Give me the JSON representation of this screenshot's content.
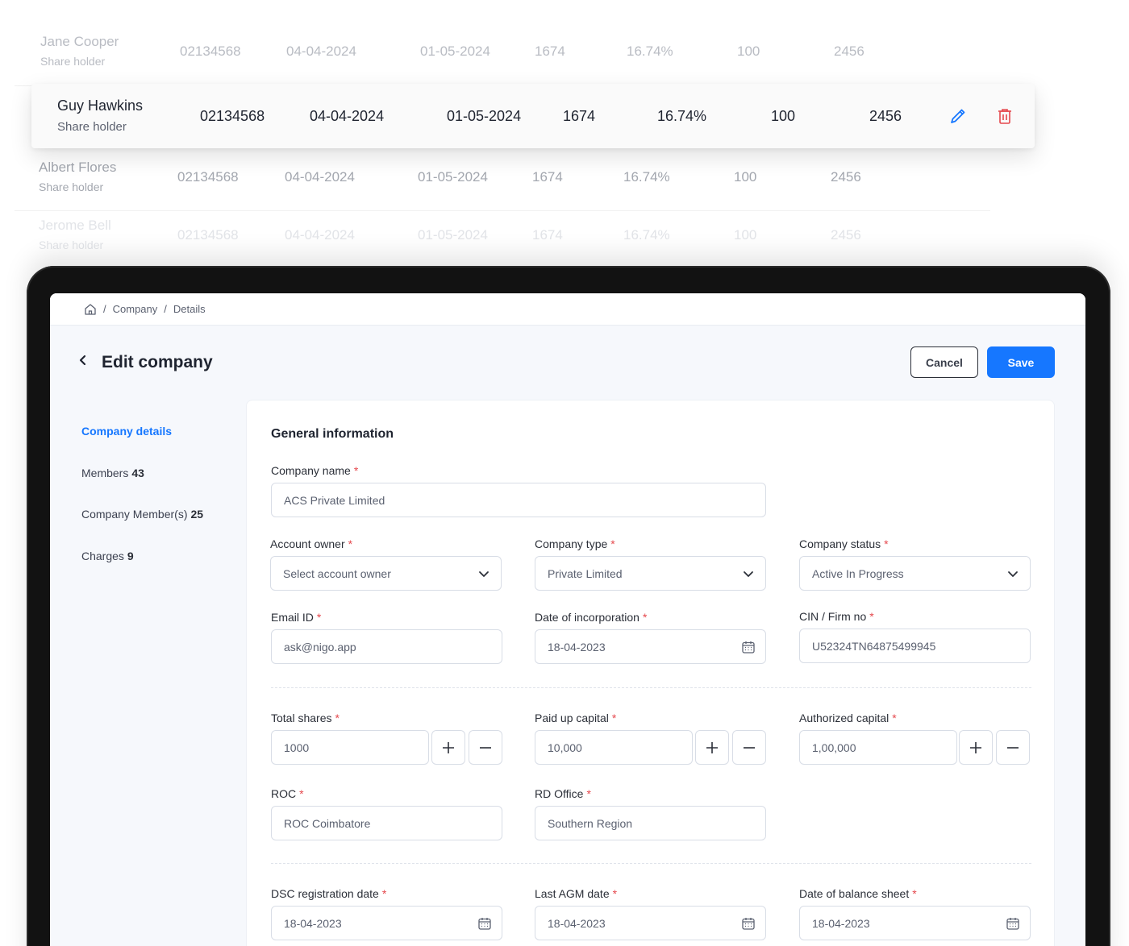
{
  "table": {
    "rows": [
      {
        "name": "Jane Cooper",
        "role": "Share holder",
        "id": "02134568",
        "date1": "04-04-2024",
        "date2": "01-05-2024",
        "c1": "1674",
        "pct": "16.74%",
        "c2": "100",
        "c3": "2456"
      },
      {
        "name": "Guy Hawkins",
        "role": "Share holder",
        "id": "02134568",
        "date1": "04-04-2024",
        "date2": "01-05-2024",
        "c1": "1674",
        "pct": "16.74%",
        "c2": "100",
        "c3": "2456"
      },
      {
        "name": "Albert Flores",
        "role": "Share holder",
        "id": "02134568",
        "date1": "04-04-2024",
        "date2": "01-05-2024",
        "c1": "1674",
        "pct": "16.74%",
        "c2": "100",
        "c3": "2456"
      },
      {
        "name": "Jerome Bell",
        "role": "Share holder",
        "id": "02134568",
        "date1": "04-04-2024",
        "date2": "01-05-2024",
        "c1": "1674",
        "pct": "16.74%",
        "c2": "100",
        "c3": "2456"
      }
    ],
    "edit_icon": "pencil-icon",
    "delete_icon": "trash-icon",
    "edit_color": "#1677ff",
    "delete_color": "#e5484d"
  },
  "breadcrumb": {
    "home_icon": "home-icon",
    "items": [
      "Company",
      "Details"
    ]
  },
  "header": {
    "title": "Edit company",
    "cancel_label": "Cancel",
    "save_label": "Save"
  },
  "sidebar": {
    "items": [
      {
        "label": "Company details",
        "count": ""
      },
      {
        "label": "Members",
        "count": "43"
      },
      {
        "label": "Company Member(s)",
        "count": "25"
      },
      {
        "label": "Charges",
        "count": "9"
      }
    ]
  },
  "form": {
    "section_title": "General information",
    "company_name": {
      "label": "Company name",
      "value": "ACS Private Limited"
    },
    "account_owner": {
      "label": "Account owner",
      "placeholder": "Select account owner"
    },
    "company_type": {
      "label": "Company type",
      "value": "Private Limited"
    },
    "company_status": {
      "label": "Company status",
      "value": "Active In Progress"
    },
    "email": {
      "label": "Email ID",
      "value": "ask@nigo.app"
    },
    "incorporation_date": {
      "label": "Date of incorporation",
      "value": "18-04-2023"
    },
    "cin": {
      "label": "CIN / Firm no",
      "value": "U52324TN64875499945"
    },
    "total_shares": {
      "label": "Total shares",
      "value": "1000"
    },
    "paid_up_capital": {
      "label": "Paid up capital",
      "value": "10,000"
    },
    "authorized_capital": {
      "label": "Authorized capital",
      "value": "1,00,000"
    },
    "roc": {
      "label": "ROC",
      "value": "ROC Coimbatore"
    },
    "rd_office": {
      "label": "RD Office",
      "value": "Southern Region"
    },
    "dsc_date": {
      "label": "DSC registration date",
      "value": "18-04-2023"
    },
    "agm_date": {
      "label": "Last AGM date",
      "value": "18-04-2023"
    },
    "balance_sheet_date": {
      "label": "Date of balance sheet",
      "value": "18-04-2023"
    },
    "required_mark": "*"
  },
  "colors": {
    "accent": "#1677ff",
    "required": "#e5484d"
  }
}
